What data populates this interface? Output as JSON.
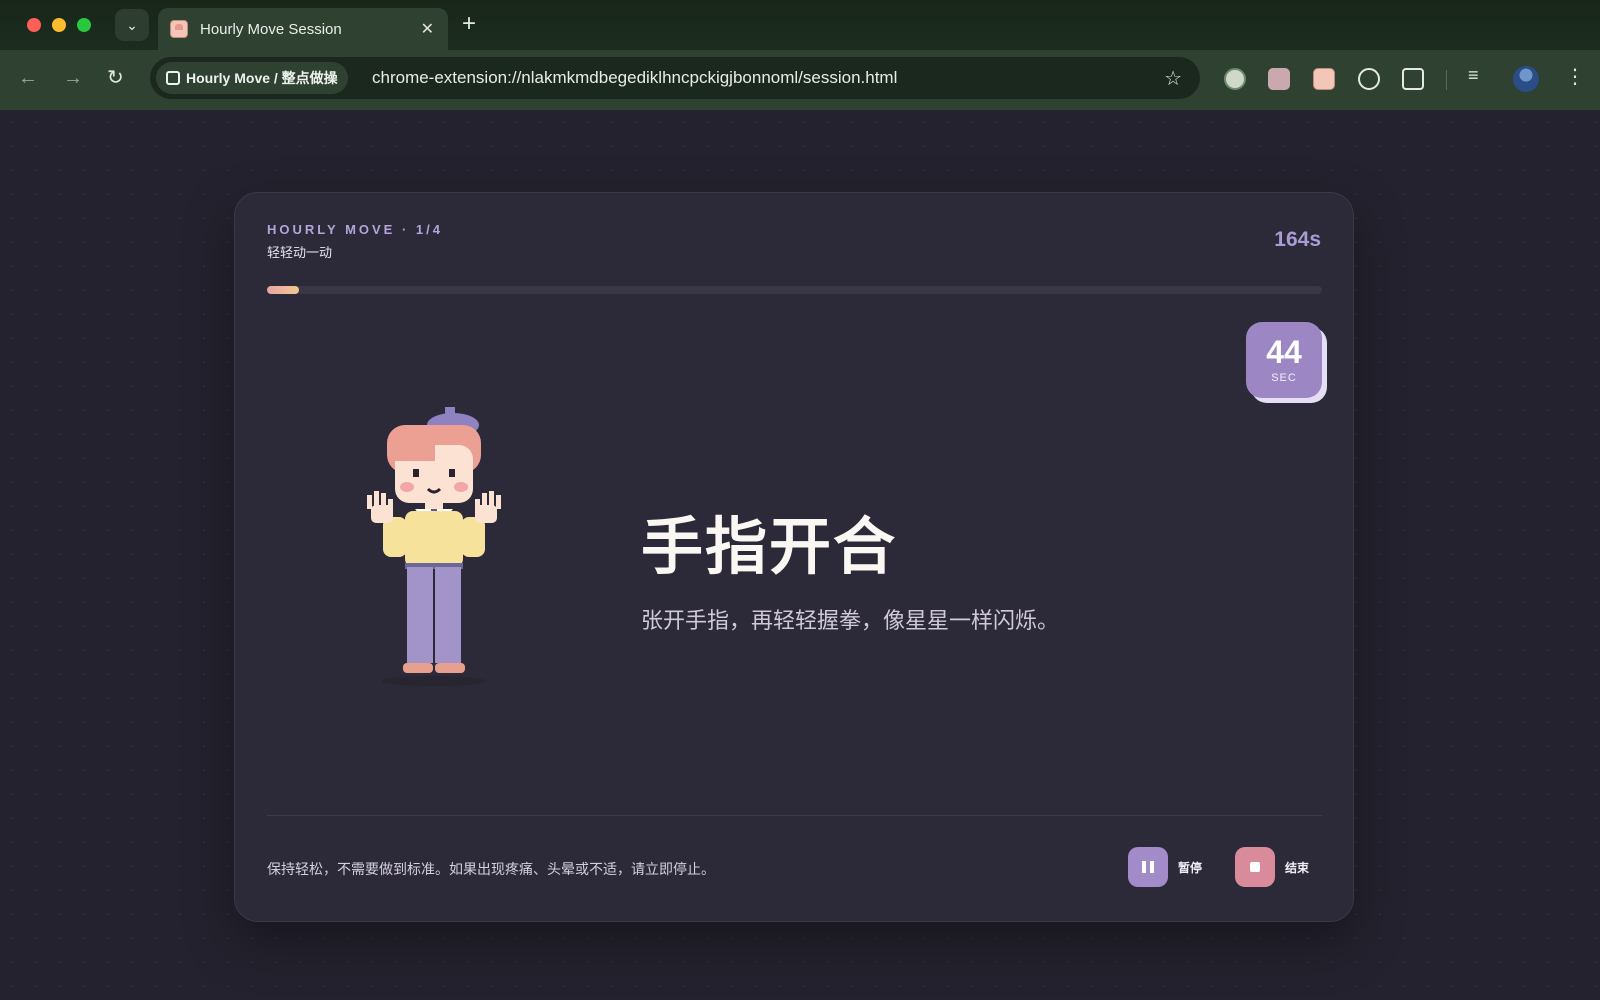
{
  "browser": {
    "tab_title": "Hourly Move Session",
    "site_chip": "Hourly Move / 整点做操",
    "url": "chrome-extension://nlakmkmdbegediklhncpckigjbonnoml/session.html"
  },
  "session": {
    "eyebrow": "HOURLY MOVE · 1/4",
    "subtitle": "轻轻动一动",
    "total_time": "164s",
    "progress": 0.03,
    "countdown": "44",
    "countdown_unit": "SEC"
  },
  "exercise": {
    "title": "手指开合",
    "description": "张开手指，再轻轻握拳，像星星一样闪烁。"
  },
  "footer": {
    "note": "保持轻松，不需要做到标准。如果出现疼痛、头晕或不适，请立即停止。",
    "pause_label": "暂停",
    "end_label": "结束"
  },
  "colors": {
    "accent": "#9d86c4",
    "stop": "#d98b9c",
    "progress_start": "#e8a3a5",
    "progress_end": "#f1c98e"
  }
}
